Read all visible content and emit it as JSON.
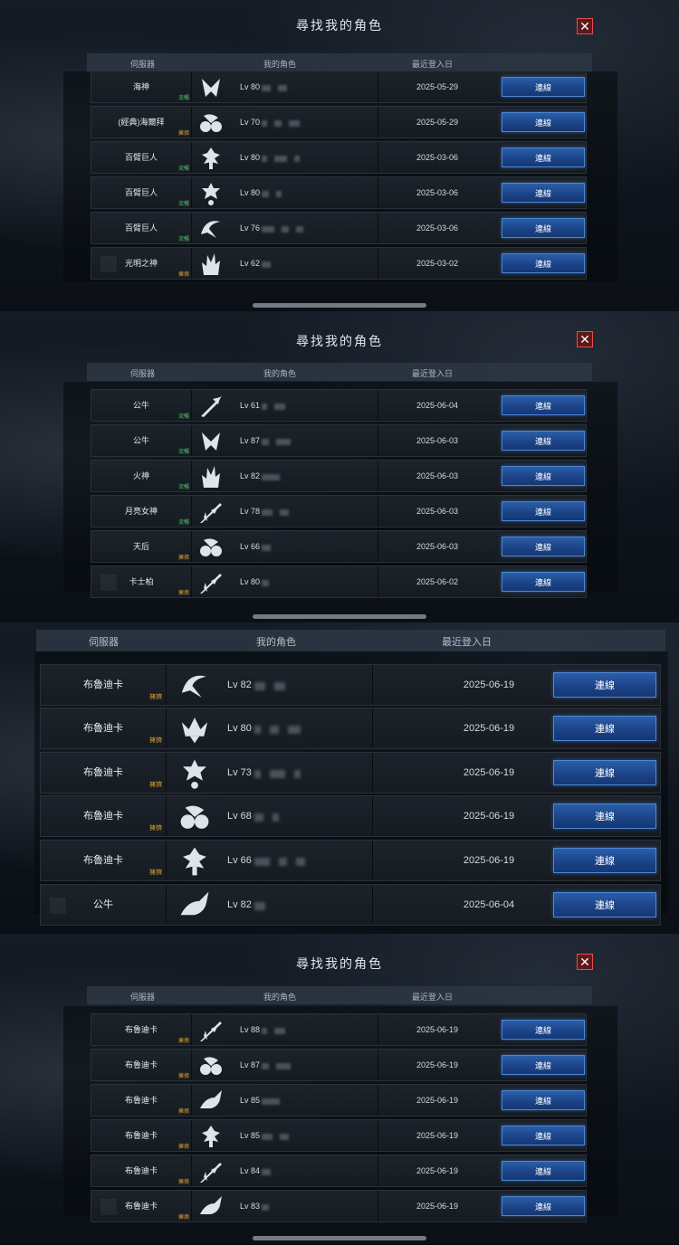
{
  "panels": [
    {
      "title": "尋找我的角色",
      "headers": {
        "server": "伺服器",
        "character": "我的角色",
        "last_login": "最近登入日"
      },
      "rows": [
        {
          "server": "海神",
          "badge": "流暢",
          "badge_color": "#58c06a",
          "icon": "class-crest-icon",
          "level": "Lv 80",
          "date": "2025-05-29",
          "button": "連線"
        },
        {
          "server": "(經典)海爾拜",
          "badge": "擁擠",
          "badge_color": "#d8a035",
          "icon": "class-moth-icon",
          "level": "Lv 70",
          "date": "2025-05-29",
          "button": "連線"
        },
        {
          "server": "百臂巨人",
          "badge": "流暢",
          "badge_color": "#58c06a",
          "icon": "class-tree-icon",
          "level": "Lv 80",
          "date": "2025-03-06",
          "button": "連線"
        },
        {
          "server": "百臂巨人",
          "badge": "流暢",
          "badge_color": "#58c06a",
          "icon": "class-cross-icon",
          "level": "Lv 80",
          "date": "2025-03-06",
          "button": "連線"
        },
        {
          "server": "百臂巨人",
          "badge": "流暢",
          "badge_color": "#58c06a",
          "icon": "class-wave-icon",
          "level": "Lv 76",
          "date": "2025-03-06",
          "button": "連線"
        },
        {
          "server": "光明之神",
          "badge": "擁擠",
          "badge_color": "#d8a035",
          "icon": "class-flame-icon",
          "level": "Lv 62",
          "date": "2025-03-02",
          "button": "連線"
        }
      ]
    },
    {
      "title": "尋找我的角色",
      "headers": {
        "server": "伺服器",
        "character": "我的角色",
        "last_login": "最近登入日"
      },
      "rows": [
        {
          "server": "公牛",
          "badge": "流暢",
          "badge_color": "#58c06a",
          "icon": "class-spear-icon",
          "level": "Lv 61",
          "date": "2025-06-04",
          "button": "連線"
        },
        {
          "server": "公牛",
          "badge": "流暢",
          "badge_color": "#58c06a",
          "icon": "class-crest-icon",
          "level": "Lv 87",
          "date": "2025-06-03",
          "button": "連線"
        },
        {
          "server": "火神",
          "badge": "流暢",
          "badge_color": "#58c06a",
          "icon": "class-flame-icon",
          "level": "Lv 82",
          "date": "2025-06-03",
          "button": "連線"
        },
        {
          "server": "月亮女神",
          "badge": "流暢",
          "badge_color": "#58c06a",
          "icon": "class-blades-icon",
          "level": "Lv 78",
          "date": "2025-06-03",
          "button": "連線"
        },
        {
          "server": "天后",
          "badge": "擁擠",
          "badge_color": "#d8a035",
          "icon": "class-moth-icon",
          "level": "Lv 66",
          "date": "2025-06-03",
          "button": "連線"
        },
        {
          "server": "卡士柏",
          "badge": "擁擠",
          "badge_color": "#d8a035",
          "icon": "class-blades-icon",
          "level": "Lv 80",
          "date": "2025-06-02",
          "button": "連線"
        }
      ]
    },
    {
      "headers": {
        "server": "伺服器",
        "character": "我的角色",
        "last_login": "最近登入日"
      },
      "rows": [
        {
          "server": "布魯迪卡",
          "badge": "擁擠",
          "badge_color": "#d8a035",
          "icon": "class-wave-icon",
          "level": "Lv 82",
          "date": "2025-06-19",
          "button": "連線"
        },
        {
          "server": "布魯迪卡",
          "badge": "擁擠",
          "badge_color": "#d8a035",
          "icon": "class-crown-icon",
          "level": "Lv 80",
          "date": "2025-06-19",
          "button": "連線"
        },
        {
          "server": "布魯迪卡",
          "badge": "擁擠",
          "badge_color": "#d8a035",
          "icon": "class-cross-icon",
          "level": "Lv 73",
          "date": "2025-06-19",
          "button": "連線"
        },
        {
          "server": "布魯迪卡",
          "badge": "擁擠",
          "badge_color": "#d8a035",
          "icon": "class-moth-icon",
          "level": "Lv 68",
          "date": "2025-06-19",
          "button": "連線"
        },
        {
          "server": "布魯迪卡",
          "badge": "擁擠",
          "badge_color": "#d8a035",
          "icon": "class-tree-icon",
          "level": "Lv 66",
          "date": "2025-06-19",
          "button": "連線"
        },
        {
          "server": "公牛",
          "badge": "",
          "badge_color": "#58c06a",
          "icon": "class-beast-icon",
          "level": "Lv 82",
          "date": "2025-06-04",
          "button": "連線"
        }
      ]
    },
    {
      "title": "尋找我的角色",
      "headers": {
        "server": "伺服器",
        "character": "我的角色",
        "last_login": "最近登入日"
      },
      "rows": [
        {
          "server": "布魯迪卡",
          "badge": "擁擠",
          "badge_color": "#d8a035",
          "icon": "class-blades-icon",
          "level": "Lv 88",
          "date": "2025-06-19",
          "button": "連線"
        },
        {
          "server": "布魯迪卡",
          "badge": "擁擠",
          "badge_color": "#d8a035",
          "icon": "class-moth-icon",
          "level": "Lv 87",
          "date": "2025-06-19",
          "button": "連線"
        },
        {
          "server": "布魯迪卡",
          "badge": "擁擠",
          "badge_color": "#d8a035",
          "icon": "class-beast-icon",
          "level": "Lv 85",
          "date": "2025-06-19",
          "button": "連線"
        },
        {
          "server": "布魯迪卡",
          "badge": "擁擠",
          "badge_color": "#d8a035",
          "icon": "class-tree-icon",
          "level": "Lv 85",
          "date": "2025-06-19",
          "button": "連線"
        },
        {
          "server": "布魯迪卡",
          "badge": "擁擠",
          "badge_color": "#d8a035",
          "icon": "class-blades-icon",
          "level": "Lv 84",
          "date": "2025-06-19",
          "button": "連線"
        },
        {
          "server": "布魯迪卡",
          "badge": "擁擠",
          "badge_color": "#d8a035",
          "icon": "class-beast-icon",
          "level": "Lv 83",
          "date": "2025-06-19",
          "button": "連線"
        }
      ]
    }
  ],
  "close_icon": "close-icon",
  "colors": {
    "accent_button": "#1c4488",
    "close_red": "#e05050",
    "ok_green": "#58c06a",
    "busy_orange": "#d8a035"
  }
}
